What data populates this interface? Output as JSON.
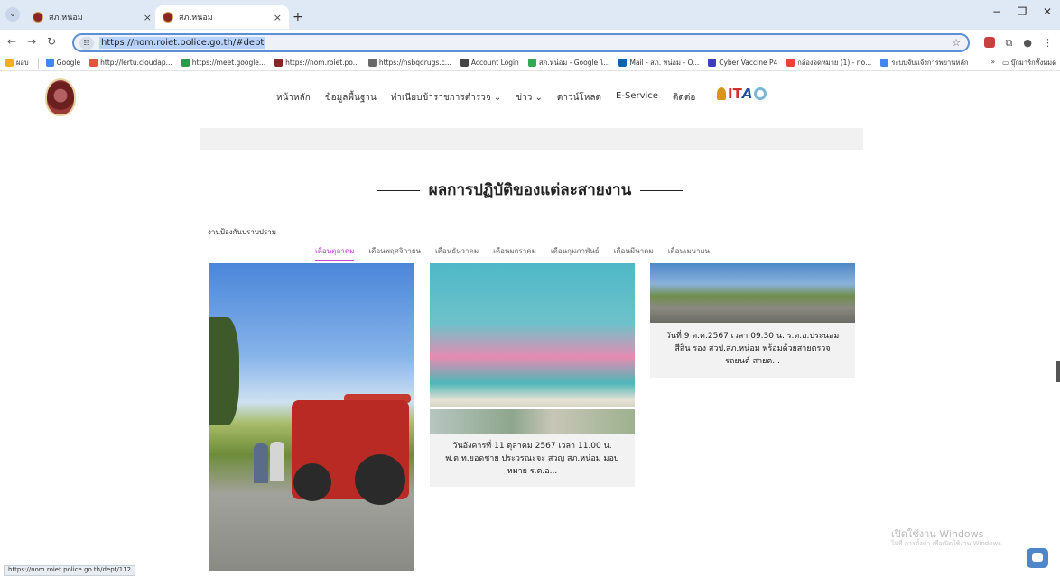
{
  "browser": {
    "tabs": [
      {
        "title": "สภ.หน่อม",
        "active": false
      },
      {
        "title": "สภ.หน่อม",
        "active": true
      }
    ],
    "new_tab": "+",
    "url": "https://nom.roiet.police.go.th/#dept",
    "status_url": "https://nom.roiet.police.go.th/dept/112",
    "bookmarks": [
      {
        "label": "ผอบ",
        "icon": "apps-icon"
      },
      {
        "label": "Google",
        "icon": "google-icon"
      },
      {
        "label": "http://lertu.cloudap...",
        "icon": "link-icon"
      },
      {
        "label": "https://meet.google...",
        "icon": "meet-icon"
      },
      {
        "label": "https://nom.roiet.po...",
        "icon": "police-icon"
      },
      {
        "label": "https://nsbqdrugs.c...",
        "icon": "link-icon"
      },
      {
        "label": "Account Login",
        "icon": "home-icon"
      },
      {
        "label": "สภ.หน่อม - Google ไ...",
        "icon": "drive-icon"
      },
      {
        "label": "Mail - สภ. หน่อม - O...",
        "icon": "mail-icon"
      },
      {
        "label": "Cyber Vaccine P4",
        "icon": "cyber-icon"
      },
      {
        "label": "กล่องจดหมาย (1) - nо...",
        "icon": "gmail-icon"
      },
      {
        "label": "ระบบจับแจ้งการพยานหลัก",
        "icon": "google-icon"
      }
    ],
    "bookmarks_more": "»",
    "all_bookmarks": "บุ๊กมาร์กทั้งหมด"
  },
  "site": {
    "menu": [
      "หน้าหลัก",
      "ข้อมูลพื้นฐาน",
      "ทำเนียบข้าราชการตำรวจ ⌄",
      "ข่าว ⌄",
      "ดาวน์โหลด",
      "E-Service",
      "ติดต่อ"
    ],
    "ita_text_1": "IT",
    "ita_text_2": "A"
  },
  "section": {
    "title": "ผลการปฏิบัติของแต่ละสายงาน",
    "dept_label": "งานป้องกันปราบปราม",
    "month_tabs": [
      "เดือนตุลาคม",
      "เดือนพฤศจิกายน",
      "เดือนธันวาคม",
      "เดือนมกราคม",
      "เดือนกุมภาพันธ์",
      "เดือนมีนาคม",
      "เดือนเมษายน"
    ],
    "active_month": 0
  },
  "cards": [
    {
      "caption": ""
    },
    {
      "caption": "วันอังคารที่ 11 ตุลาคม 2567 เวลา 11.00 น. พ.ต.ท.ยอดชาย ประวรณะจะ สวญ สภ.หน่อม มอบหมาย ร.ต.อ..."
    },
    {
      "caption": "วันที่ 9 ต.ค.2567 เวลา 09.30 น. ร.ต.อ.ประนอม สีสิน รอง สวป.สภ.หน่อม พร้อมด้วยสายตรวจรถยนต์ สายต..."
    }
  ],
  "os": {
    "watermark": "เปิดใช้งาน Windows",
    "watermark_sub": "ไปที่ การตั้งค่า เพื่อเปิดใช้งาน Windows"
  }
}
